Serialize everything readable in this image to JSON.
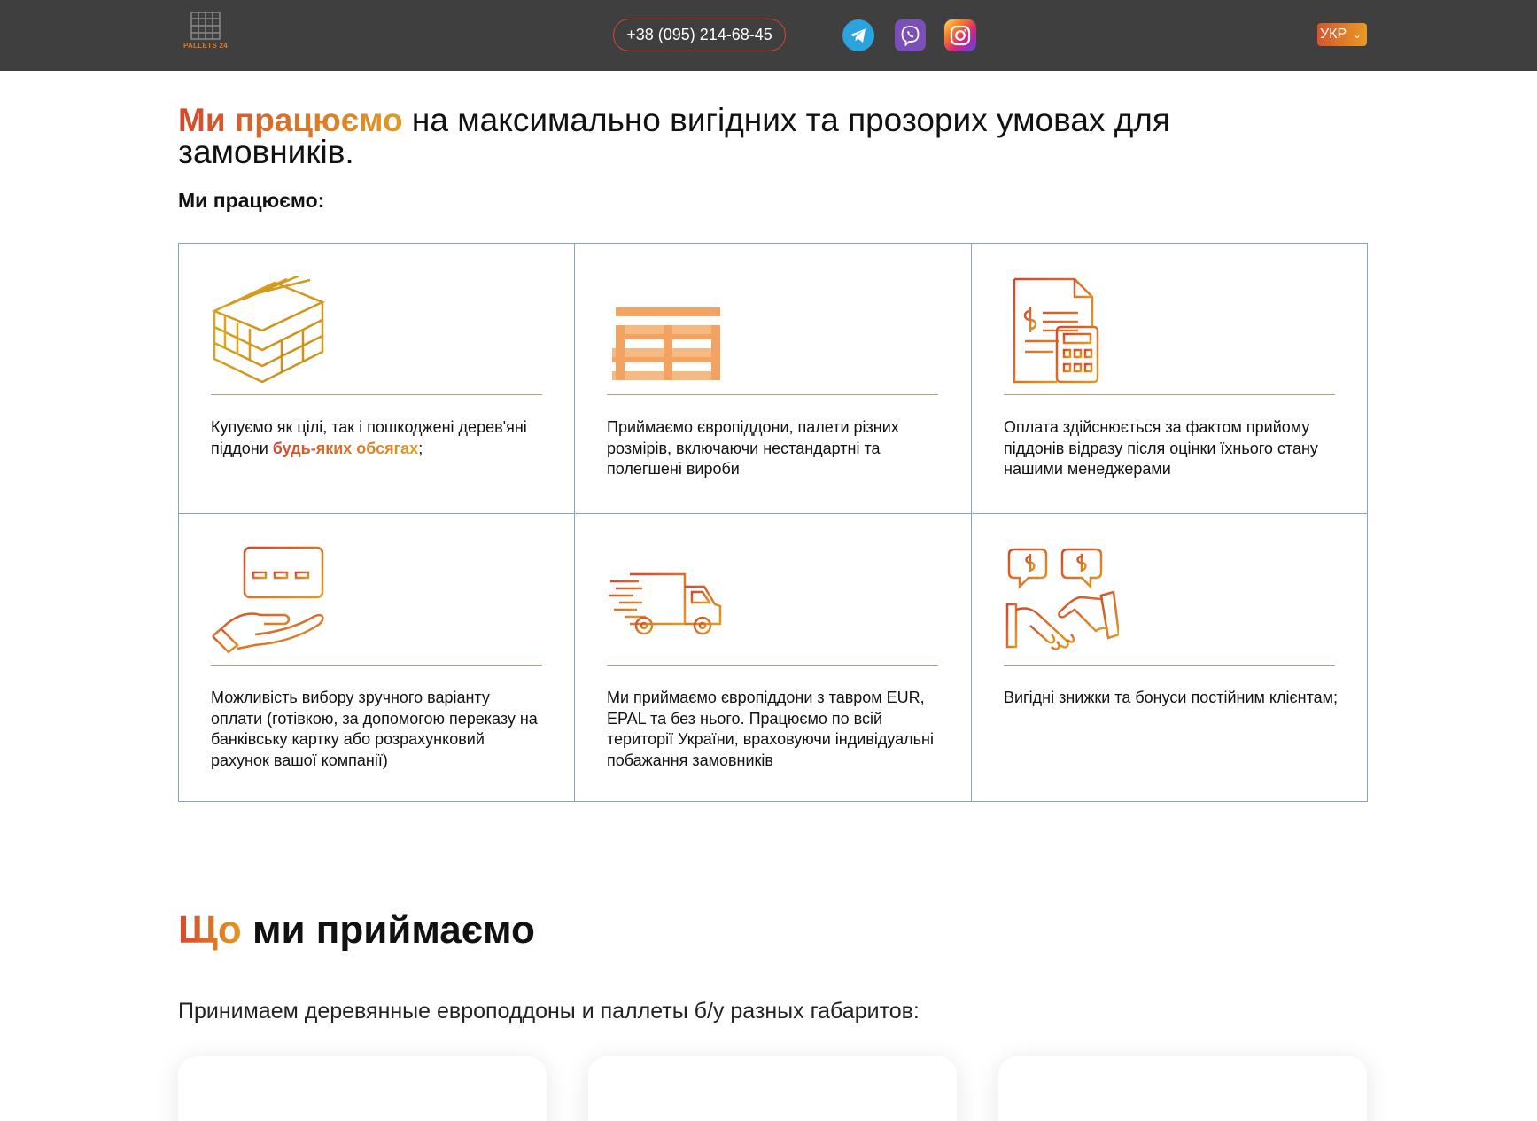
{
  "header": {
    "logo_text": "PALLETS 24",
    "phone": "+38 (095) 214-68-45",
    "social": [
      "telegram-icon",
      "viber-icon",
      "instagram-icon"
    ],
    "language": "УКР"
  },
  "section_work": {
    "title_accent": "Ми працюємо",
    "title_rest": " на максимально вигідних та прозорих умовах для замовників.",
    "subtitle": "Ми працюємо:",
    "items": [
      {
        "icon": "pallet-stack-icon",
        "text_before": "Купуємо як цілі, так і пошкоджені дерев'яні піддони ",
        "highlight": "будь-яких обсягах",
        "text_after": ";"
      },
      {
        "icon": "europallet-icon",
        "text": "Приймаємо європіддони, палети різних розмірів, включаючи нестандартні та полегшені вироби"
      },
      {
        "icon": "invoice-calculator-icon",
        "text": "Оплата здійснюється за фактом прийому піддонів відразу після оцінки їхнього стану нашими менеджерами"
      },
      {
        "icon": "card-in-hand-icon",
        "text": "Можливість вибору зручного варіанту оплати (готівкою, за допомогою переказу на банківську картку або розрахунковий рахунок вашої компанії)"
      },
      {
        "icon": "delivery-truck-icon",
        "text": "Ми приймаємо європіддони з тавром EUR, EPAL та без нього. Працюємо по всій території України, враховуючи індивідуальні побажання замовників"
      },
      {
        "icon": "handshake-icon",
        "text": "Вигідні знижки та бонуси постійним клієнтам;"
      }
    ]
  },
  "section_accept": {
    "title_accent": "Що",
    "title_rest": " ми приймаємо",
    "paragraph": "Принимаем деревянные европоддоны и паллеты б/у разных габаритов:"
  },
  "colors": {
    "header_bg": "#3f3f3f",
    "accent_start": "#d2492f",
    "accent_end": "#e19b22",
    "grid_border": "#8aa0c8"
  }
}
